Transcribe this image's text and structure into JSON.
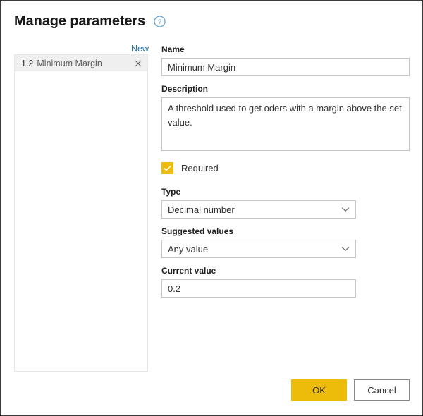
{
  "dialog": {
    "title": "Manage parameters",
    "help_icon": "help-circle-icon"
  },
  "list_panel": {
    "new_link_label": "New",
    "items": [
      {
        "type_marker": "1.2",
        "label": "Minimum Margin",
        "close_icon": "close-x-icon",
        "selected": true
      }
    ]
  },
  "form": {
    "name": {
      "label": "Name",
      "value": "Minimum Margin",
      "placeholder": ""
    },
    "description": {
      "label": "Description",
      "value": "A threshold used to get oders with a margin above the set value.",
      "placeholder": ""
    },
    "required": {
      "label": "Required",
      "checked": true,
      "check_icon": "checkmark-icon"
    },
    "type": {
      "label": "Type",
      "value": "Decimal number",
      "chevron_icon": "chevron-down-icon"
    },
    "suggested_values": {
      "label": "Suggested values",
      "value": "Any value",
      "chevron_icon": "chevron-down-icon"
    },
    "current_value": {
      "label": "Current value",
      "value": "0.2",
      "placeholder": ""
    }
  },
  "footer": {
    "ok_label": "OK",
    "cancel_label": "Cancel"
  },
  "colors": {
    "accent_yellow": "#edbb0a",
    "link_blue": "#2574b5",
    "help_blue": "#5a9fd4",
    "border_gray": "#c8c6c4",
    "selected_row": "#efefef"
  }
}
